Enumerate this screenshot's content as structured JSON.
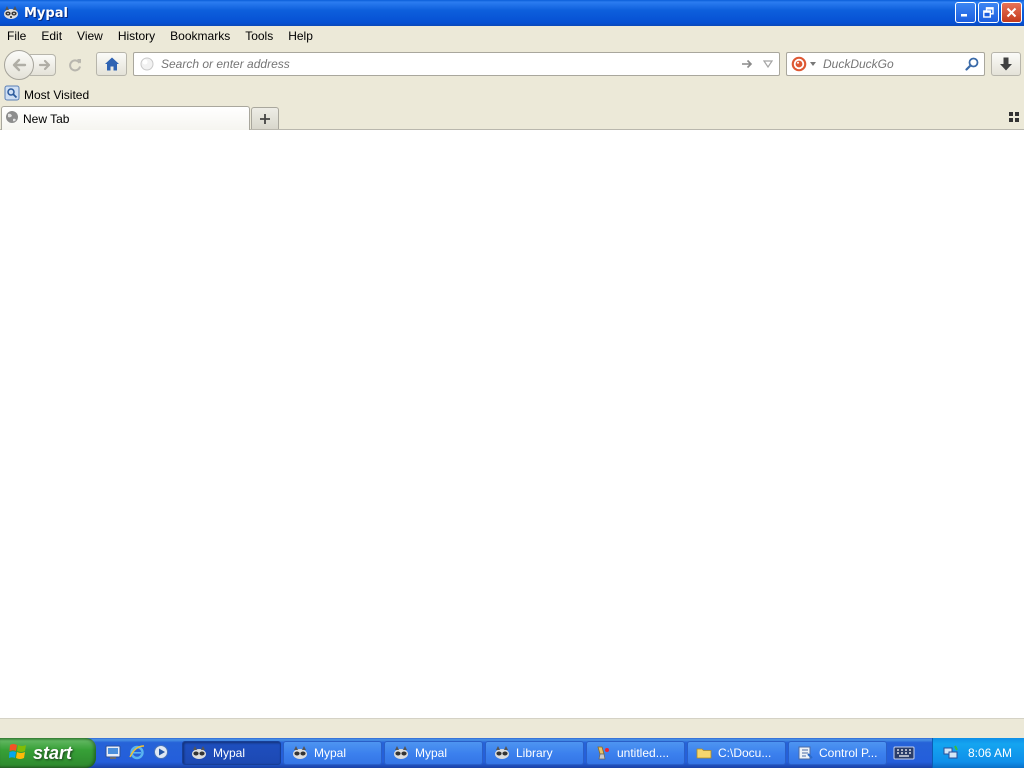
{
  "window": {
    "title": "Mypal",
    "app_icon": "raccoon-icon",
    "controls": [
      "minimize-icon",
      "restore-icon",
      "close-icon"
    ]
  },
  "menu": {
    "items": [
      {
        "label": "File"
      },
      {
        "label": "Edit"
      },
      {
        "label": "View"
      },
      {
        "label": "History"
      },
      {
        "label": "Bookmarks"
      },
      {
        "label": "Tools"
      },
      {
        "label": "Help"
      }
    ]
  },
  "navbar": {
    "url_value": "",
    "url_placeholder": "Search or enter address",
    "search_value": "",
    "search_placeholder": "DuckDuckGo"
  },
  "bookmarks": {
    "items": [
      {
        "label": "Most Visited"
      }
    ]
  },
  "tabs": {
    "items": [
      {
        "label": "New Tab",
        "active": true
      }
    ]
  },
  "taskbar": {
    "start_label": "start",
    "quicklaunch": [
      "show-desktop-icon",
      "internet-explorer-icon",
      "media-player-icon"
    ],
    "tasks": [
      {
        "label": "Mypal",
        "icon": "raccoon-icon",
        "active": true
      },
      {
        "label": "Mypal",
        "icon": "raccoon-icon",
        "active": false
      },
      {
        "label": "Mypal",
        "icon": "raccoon-icon",
        "active": false
      },
      {
        "label": "Library",
        "icon": "raccoon-icon",
        "active": false
      },
      {
        "label": "untitled....",
        "icon": "paint-icon",
        "active": false
      },
      {
        "label": "C:\\Docu...",
        "icon": "folder-icon",
        "active": false
      },
      {
        "label": "Control P...",
        "icon": "control-panel-icon",
        "active": false
      }
    ],
    "clock": "8:06 AM"
  },
  "colors": {
    "titlebar": "#0a5ed8",
    "chrome": "#ece9d8",
    "taskbar": "#245edb",
    "start_button": "#37a037",
    "tray": "#0f8fea"
  }
}
